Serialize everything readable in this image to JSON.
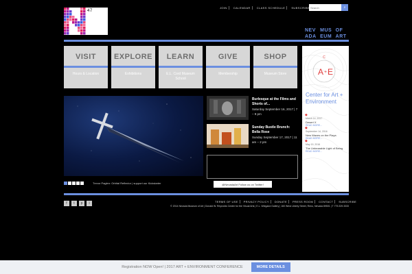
{
  "logo": {
    "count": "47"
  },
  "topnav": [
    "JOIN",
    "CALENDAR",
    "CLASS SCHEDULE",
    "SUBSCRIBE"
  ],
  "search": {
    "placeholder": "Search",
    "button_icon": "search-icon"
  },
  "brand": [
    "NEV",
    "MUS",
    "OF",
    "ADA",
    "EUM",
    "ART"
  ],
  "tiles": [
    {
      "title": "VISIT",
      "sub": "Hours & Location"
    },
    {
      "title": "EXPLORE",
      "sub": "Exhibitions"
    },
    {
      "title": "LEARN",
      "sub": "E.L. Cord Museum School"
    },
    {
      "title": "GIVE",
      "sub": "Membership"
    },
    {
      "title": "SHOP",
      "sub": "Museum Store"
    }
  ],
  "cae": {
    "title": "Center for Art + Environment",
    "items": [
      {
        "date": "March 14, 2017",
        "name": "Desert X",
        "more": "READ MORE..."
      },
      {
        "date": "September 14, 2016",
        "name": "New Waves on the Playa",
        "more": "READ MORE..."
      },
      {
        "date": "May 19, 2016",
        "name": "The Unbearable Light of Being",
        "more": "READ MORE..."
      }
    ]
  },
  "hero": {
    "caption": "Trevor Paglen: Orbital Reflector | support our Kickstarter"
  },
  "events": [
    {
      "title": "Burlesque at the Films and Shorts of...",
      "date": "Saturday September 16, 2017 | 7 – 9 pm"
    },
    {
      "title": "Sunday Bustle Brunch: Bella Rose",
      "date": "Sunday September 17, 2017 | 11 am – 2 pm"
    }
  ],
  "twitter": {
    "label": "@NevadaArt Follow us on Twitter!"
  },
  "footnav": [
    "TERMS OF USE",
    "PRIVACY POLICY",
    "DONATE",
    "PRESS ROOM",
    "CONTACT",
    "SUBSCRIBE"
  ],
  "social": [
    "f",
    "t",
    "p",
    "i"
  ],
  "copyright": "© 2014 Nevada Museum of Art | Donald W. Reynolds Center for the Visual Arts | E.L. Wiegand Gallery | 160 West Liberty Street, Reno, Nevada 89501 | T 775.329.3333",
  "banner": {
    "text": "Registration NOW Open! | 2017 ART + ENVIRONMENT CONFERENCE",
    "button": "MORE DETAILS"
  },
  "colors": {
    "accent": "#6b8fe0",
    "tile_bg": "#d7d7d7",
    "tile_text": "#6e6e6e",
    "cae_red": "#e03b3b"
  }
}
